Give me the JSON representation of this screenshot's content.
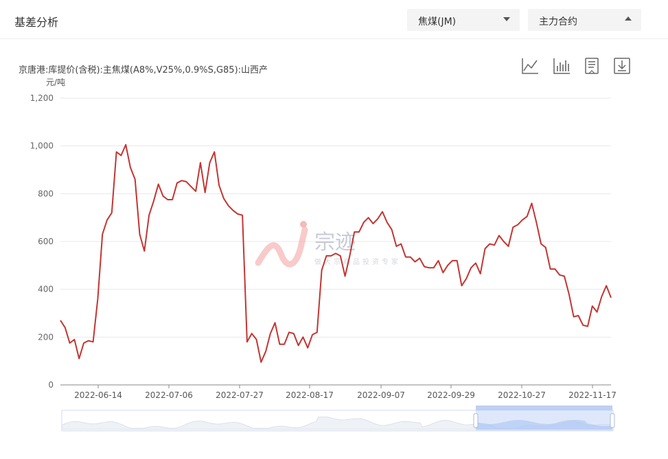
{
  "header": {
    "title": "基差分析",
    "commodity_select": "焦煤(JM)",
    "contract_select": "主力合约"
  },
  "toolbar": {
    "icons": [
      "line-chart-icon",
      "bar-chart-icon",
      "data-view-icon",
      "download-icon"
    ]
  },
  "watermark": {
    "brand": "宗迹",
    "slogan": "做大宗商品投资专家"
  },
  "chart_data": {
    "type": "line",
    "title": "京唐港:库提价(含税):主焦煤(A8%,V25%,0.9%S,G85):山西产",
    "ylabel": "元/吨",
    "ylim": [
      0,
      1200
    ],
    "y_ticks": [
      "0",
      "200",
      "400",
      "600",
      "800",
      "1,000",
      "1,200"
    ],
    "x_ticks": [
      "2022-06-14",
      "2022-07-06",
      "2022-07-27",
      "2022-08-17",
      "2022-09-07",
      "2022-09-29",
      "2022-10-27",
      "2022-11-17"
    ],
    "grid": true,
    "color": "#c23531",
    "series": [
      {
        "values": [
          270,
          240,
          175,
          190,
          110,
          175,
          185,
          180,
          360,
          630,
          690,
          720,
          975,
          960,
          1005,
          910,
          860,
          630,
          560,
          710,
          770,
          840,
          790,
          775,
          775,
          845,
          855,
          850,
          830,
          810,
          930,
          805,
          930,
          975,
          835,
          780,
          750,
          730,
          715,
          710,
          180,
          215,
          190,
          95,
          140,
          215,
          260,
          170,
          170,
          220,
          215,
          165,
          200,
          155,
          210,
          220,
          480,
          540,
          540,
          550,
          540,
          455,
          540,
          640,
          640,
          680,
          700,
          675,
          695,
          725,
          680,
          650,
          580,
          590,
          535,
          535,
          515,
          530,
          495,
          490,
          490,
          520,
          470,
          500,
          520,
          520,
          415,
          445,
          490,
          510,
          465,
          570,
          590,
          585,
          625,
          600,
          580,
          660,
          670,
          690,
          705,
          760,
          680,
          590,
          575,
          485,
          485,
          460,
          455,
          380,
          285,
          290,
          250,
          245,
          330,
          305,
          370,
          415,
          365
        ]
      }
    ]
  }
}
